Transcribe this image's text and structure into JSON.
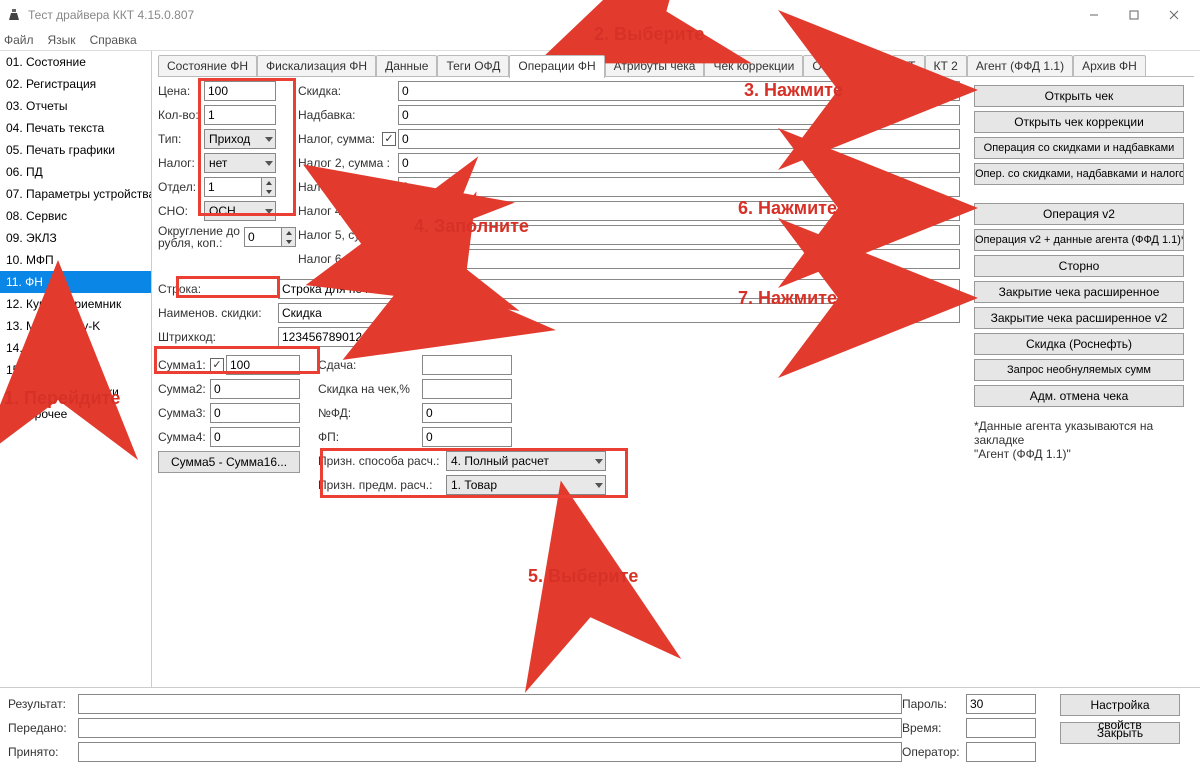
{
  "window": {
    "title": "Тест драйвера ККТ 4.15.0.807"
  },
  "menu": {
    "file": "Файл",
    "lang": "Язык",
    "help": "Справка"
  },
  "sidebar": {
    "items": [
      "01. Состояние",
      "02. Регистрация",
      "03. Отчеты",
      "04. Печать текста",
      "05. Печать графики",
      "06. ПД",
      "07. Параметры устройства",
      "08. Сервис",
      "09. ЭКЛЗ",
      "10. МФП",
      "11. ФН",
      "12. Купюроприемник",
      "13. МастерPay-K",
      "14. Модем",
      "15. БД чеков",
      "16. Онлайн платежи",
      "17. Прочее"
    ],
    "selected_index": 10
  },
  "tabs": {
    "items": [
      "Состояние ФН",
      "Фискализация ФН",
      "Данные",
      "Теги ОФД",
      "Операции ФН",
      "Атрибуты чека",
      "Чек коррекции",
      "ОФД",
      "РНМ",
      "КТ",
      "КТ 2",
      "Агент (ФФД 1.1)",
      "Архив ФН"
    ],
    "active_index": 4
  },
  "fields": {
    "price_label": "Цена:",
    "price": "100",
    "qty_label": "Кол-во:",
    "qty": "1",
    "type_label": "Тип:",
    "type": "Приход",
    "tax_label": "Налог:",
    "tax": "нет",
    "dept_label": "Отдел:",
    "dept": "1",
    "sno_label": "СНО:",
    "sno": "ОСН",
    "round_label": "Округление до\nрубля, коп.:",
    "round": "0",
    "discount_label": "Скидка:",
    "discount": "0",
    "addon_label": "Надбавка:",
    "addon": "0",
    "taxsum_label": "Налог, сумма:",
    "taxsum": "0",
    "tax2_label": "Налог 2, сумма :",
    "tax2": "0",
    "tax3_label": "Налог 3, сумма :",
    "tax3": "0",
    "tax4_label": "Налог 4, сумма :",
    "tax4": "0",
    "tax5_label": "Налог 5, сумма :",
    "tax5": "0",
    "tax6_label": "Налог 6, сумма :",
    "tax6": "0",
    "string_label": "Строка:",
    "string": "Строка для печати",
    "discname_label": "Наименов. скидки:",
    "discname": "Скидка",
    "barcode_label": "Штрихкод:",
    "barcode": "123456789012",
    "sum1_label": "Сумма1:",
    "sum1": "100",
    "sum2_label": "Сумма2:",
    "sum2": "0",
    "sum3_label": "Сумма3:",
    "sum3": "0",
    "sum4_label": "Сумма4:",
    "sum4": "0",
    "sum5btn": "Сумма5 - Сумма16...",
    "change_label": "Сдача:",
    "change": "",
    "cheqdisc_label": "Скидка на чек,%",
    "cheqdisc": "",
    "fdnum_label": "№ФД:",
    "fdnum": "0",
    "fp_label": "ФП:",
    "fp": "0",
    "paymethod_label": "Призн. способа расч.:",
    "paymethod": "4. Полный расчет",
    "paysubj_label": "Призн. предм. расч.:",
    "paysubj": "1. Товар"
  },
  "buttons": {
    "open": "Открыть чек",
    "open_corr": "Открыть чек коррекции",
    "op_disc": "Операция со скидками и надбавками",
    "op_disc_tax": "Опер. со скидками, надбавками и налогом",
    "op_v2": "Операция v2",
    "op_v2_agent": "Операция v2 + данные агента (ФФД 1.1)*",
    "storno": "Сторно",
    "close_ext": "Закрытие чека расширенное",
    "close_ext_v2": "Закрытие чека расширенное v2",
    "rosneft": "Скидка (Роснефть)",
    "nonzero": "Запрос необнуляемых сумм",
    "admcancel": "Адм. отмена чека"
  },
  "note": {
    "line1": "*Данные агента указываются на закладке",
    "line2": "\"Агент (ФФД 1.1)\""
  },
  "bottom": {
    "result": "Результат:",
    "sent": "Передано:",
    "recv": "Принято:",
    "password": "Пароль:",
    "password_value": "30",
    "time": "Время:",
    "operator": "Оператор:",
    "settings_btn": "Настройка свойств",
    "close_btn": "Закрыть"
  },
  "annotations": {
    "a1": "1. Перейдите",
    "a2": "2. Выберите",
    "a3": "3. Нажмите",
    "a4": "4. Заполните",
    "a5": "5. Выберите",
    "a6": "6. Нажмите",
    "a7": "7. Нажмите"
  }
}
